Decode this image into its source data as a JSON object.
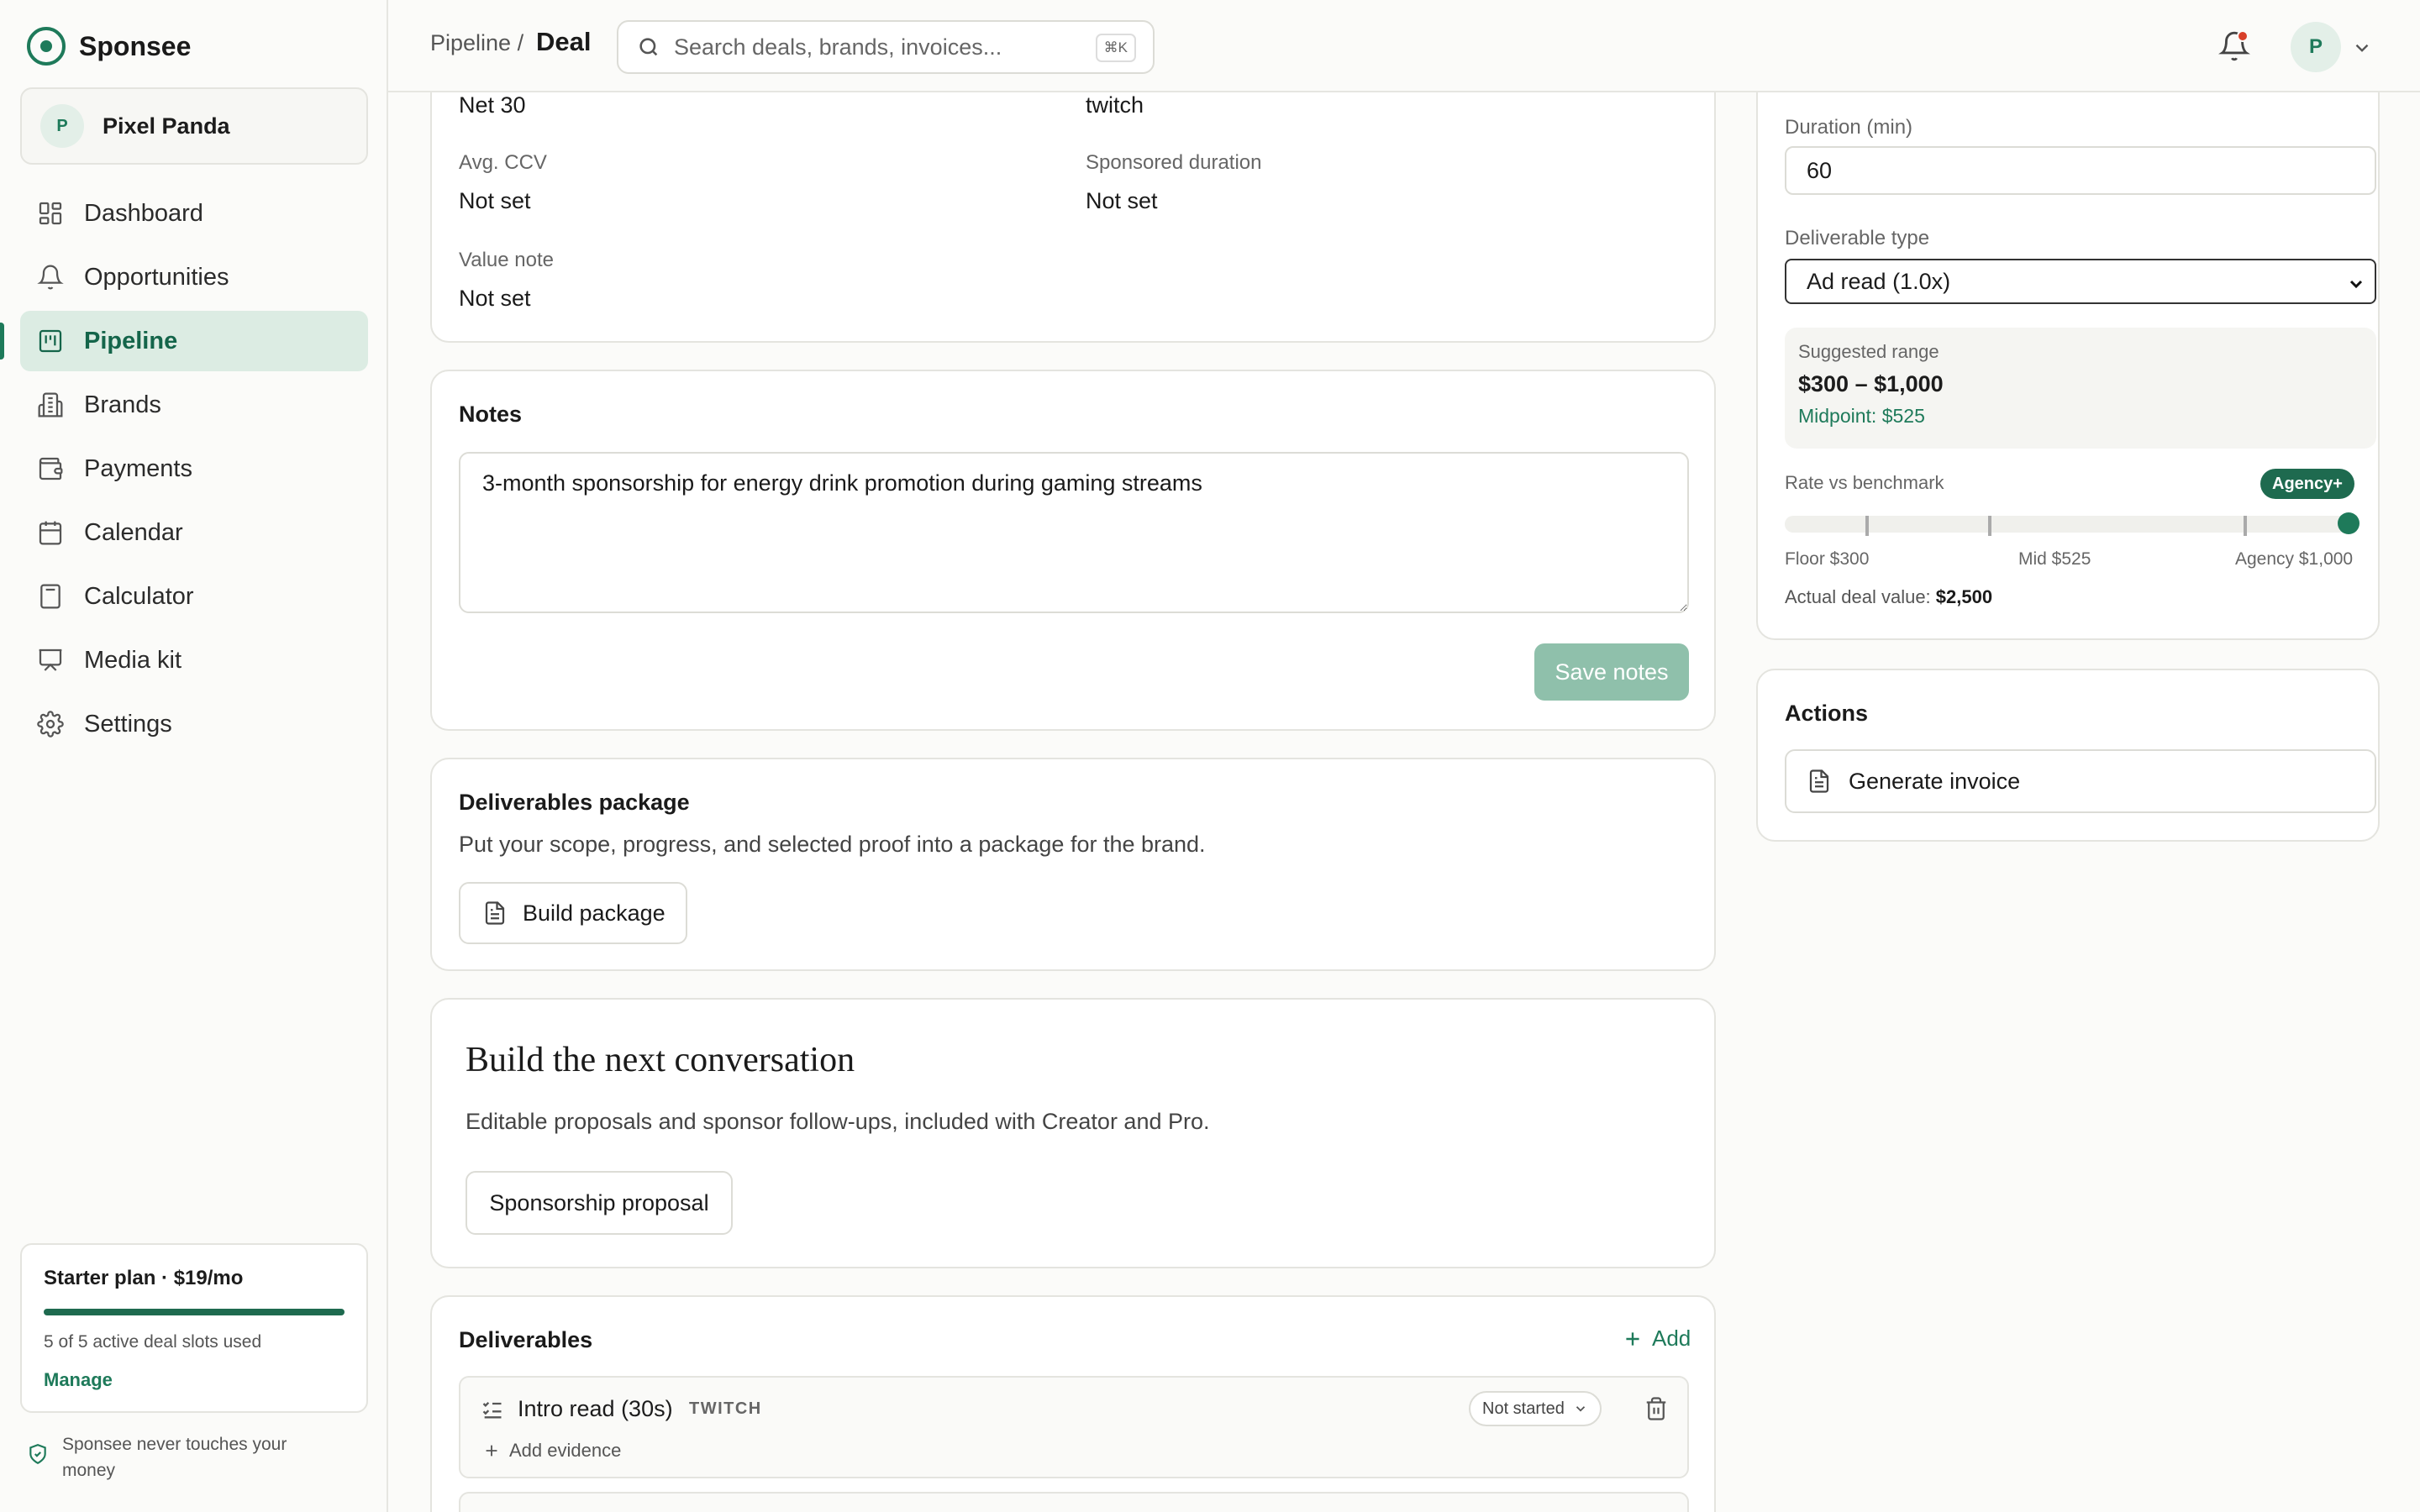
{
  "app": {
    "name": "Sponsee"
  },
  "account": {
    "initial": "P",
    "name": "Pixel Panda"
  },
  "nav": {
    "items": [
      {
        "label": "Dashboard"
      },
      {
        "label": "Opportunities"
      },
      {
        "label": "Pipeline",
        "active": true
      },
      {
        "label": "Brands"
      },
      {
        "label": "Payments"
      },
      {
        "label": "Calendar"
      },
      {
        "label": "Calculator"
      },
      {
        "label": "Media kit"
      },
      {
        "label": "Settings"
      }
    ]
  },
  "plan": {
    "title": "Starter plan · $19/mo",
    "usage": "5 of 5 active deal slots used",
    "used_fraction": 1.0,
    "manage": "Manage"
  },
  "safety_note": "Sponsee never touches your money",
  "topbar": {
    "breadcrumb_parent": "Pipeline /",
    "breadcrumb_current": "Deal",
    "search_placeholder": "Search deals, brands, invoices...",
    "search_shortcut": "⌘K",
    "user_initial": "P"
  },
  "details": {
    "payment_terms_value": "Net 30",
    "platform_value": "twitch",
    "avg_ccv_label": "Avg. CCV",
    "avg_ccv_value": "Not set",
    "sponsored_duration_label": "Sponsored duration",
    "sponsored_duration_value": "Not set",
    "value_note_label": "Value note",
    "value_note_value": "Not set"
  },
  "notes": {
    "title": "Notes",
    "text": "3-month sponsorship for energy drink promotion during gaming streams",
    "save_label": "Save notes"
  },
  "package": {
    "title": "Deliverables package",
    "description": "Put your scope, progress, and selected proof into a package for the brand.",
    "button": "Build package"
  },
  "conversation": {
    "title": "Build the next conversation",
    "description": "Editable proposals and sponsor follow-ups, included with Creator and Pro.",
    "button": "Sponsorship proposal"
  },
  "deliverables": {
    "title": "Deliverables",
    "add_label": "Add",
    "items": [
      {
        "name": "Intro read (30s)",
        "platform": "TWITCH",
        "status": "Not started",
        "evidence_label": "Add evidence"
      }
    ]
  },
  "rate": {
    "duration_label": "Duration (min)",
    "duration_value": "60",
    "deliverable_type_label": "Deliverable type",
    "deliverable_type_value": "Ad read (1.0x)",
    "suggested_label": "Suggested range",
    "suggested_range": "$300 – $1,000",
    "midpoint": "Midpoint: $525",
    "benchmark_label": "Rate vs benchmark",
    "benchmark_badge": "Agency+",
    "floor_label": "Floor $300",
    "mid_label": "Mid $525",
    "agency_label": "Agency $1,000",
    "actual_label": "Actual deal value:",
    "actual_value": "$2,500"
  },
  "actions": {
    "title": "Actions",
    "generate_invoice": "Generate invoice"
  },
  "colors": {
    "accent": "#1e7a5a",
    "accent_dark": "#1e6a4f",
    "active_nav_bg": "#dcece3",
    "save_disabled": "#8fc0ab",
    "notification": "#d8402a"
  }
}
